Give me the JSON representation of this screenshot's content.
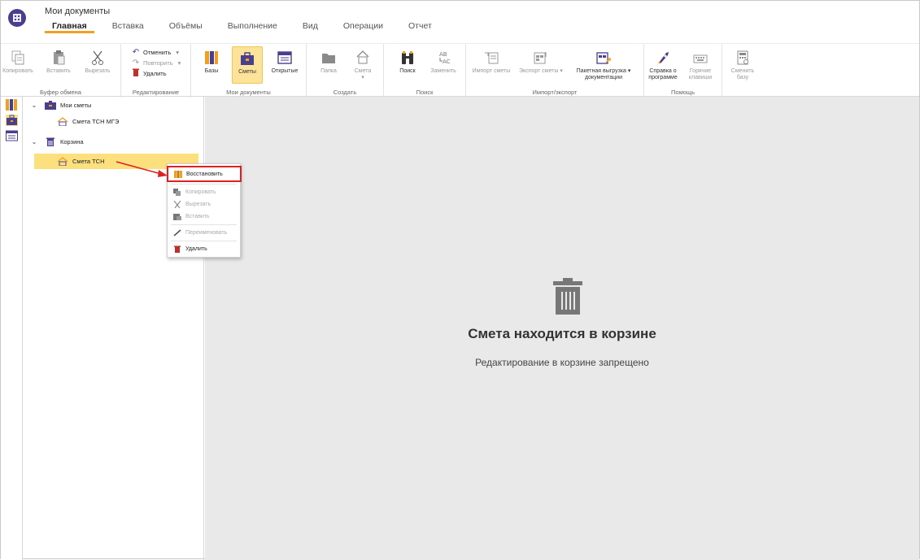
{
  "app": {
    "doc_title": "Мои документы",
    "tabs": [
      "Главная",
      "Вставка",
      "Объёмы",
      "Выполнение",
      "Вид",
      "Операции",
      "Отчет"
    ]
  },
  "ribbon": {
    "clipboard": {
      "title": "Буфер обмена",
      "copy": "Копировать",
      "paste": "Вставить",
      "cut": "Вырезать"
    },
    "editing": {
      "title": "Редактирование",
      "undo": "Отменить",
      "redo": "Повторить",
      "delete": "Удалить"
    },
    "mydocs": {
      "title": "Мои документы",
      "bases": "Базы",
      "estimates": "Сметы",
      "open": "Открытые"
    },
    "create": {
      "title": "Создать",
      "folder": "Папка",
      "estimate": "Смета"
    },
    "search": {
      "title": "Поиск",
      "find": "Поиск",
      "replace": "Заменить"
    },
    "impexp": {
      "title": "Импорт/экспорт",
      "import": "Импорт сметы",
      "export": "Экспорт сметы ▾",
      "batch1": "Пакетная выгрузка ▾",
      "batch2": "документации"
    },
    "help": {
      "title": "Помощь",
      "about1": "Справка о",
      "about2": "программе",
      "keys1": "Горячие",
      "keys2": "клавиши"
    },
    "change_base1": "Сменить",
    "change_base2": "базу"
  },
  "tree": {
    "my_estimates": "Мои сметы",
    "estimate_mge": "Смета ТСН МГЭ",
    "trash": "Корзина",
    "estimate_tsn": "Смета ТСН"
  },
  "context_menu": {
    "restore": "Восстановить",
    "copy": "Копировать",
    "cut": "Вырезать",
    "paste": "Вставить",
    "rename": "Переименовать",
    "delete": "Удалить"
  },
  "content": {
    "title": "Смета находится в корзине",
    "subtitle": "Редактирование в корзине запрещено"
  },
  "colors": {
    "accent": "#f0a020",
    "brand": "#4a3f8f",
    "highlight": "#e02020",
    "selection": "#fde07e"
  }
}
